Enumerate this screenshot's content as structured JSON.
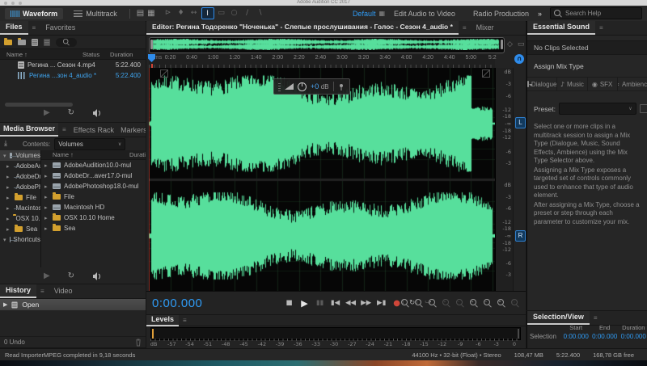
{
  "window": {
    "title": "Adobe Audition CC 2017"
  },
  "toolbar": {
    "waveform_label": "Waveform",
    "multitrack_label": "Multitrack",
    "view_toggles": [
      {
        "name": "waveform-view",
        "glyph": "▤"
      },
      {
        "name": "spectral-view",
        "glyph": "▦"
      }
    ],
    "tools": [
      {
        "name": "move",
        "glyph": "⊳",
        "active": false
      },
      {
        "name": "razor",
        "glyph": "♦",
        "active": false
      },
      {
        "name": "slip",
        "glyph": "↔",
        "active": false
      },
      {
        "name": "time-selection",
        "glyph": "I",
        "active": true
      },
      {
        "name": "marquee-selection",
        "glyph": "▭",
        "active": false
      },
      {
        "name": "lasso-selection",
        "glyph": "○",
        "active": false
      },
      {
        "name": "paintbrush",
        "glyph": "∕",
        "active": false
      },
      {
        "name": "spot-healing",
        "glyph": "∖",
        "active": false
      }
    ],
    "workspace_current": "Default",
    "workspaces": [
      "Edit Audio to Video",
      "Radio Production"
    ],
    "overflow": "»",
    "search_placeholder": "Search Help"
  },
  "files_panel": {
    "tabs": [
      "Files",
      "Favorites"
    ],
    "columns": [
      "Name ↑",
      "Status",
      "Duration"
    ],
    "rows": [
      {
        "name": "Регина ... Сезон 4.mp4",
        "duration": "5:22.400",
        "type": "video",
        "selected": false
      },
      {
        "name": "Регина ...зон 4_audio *",
        "duration": "5:22.400",
        "type": "audio",
        "selected": true
      }
    ]
  },
  "media_browser": {
    "tabs": [
      "Media Browser",
      "Effects Rack",
      "Markers"
    ],
    "overflow": "»",
    "contents_label": "Contents:",
    "contents_value": "Volumes",
    "tree_root": "Volumes",
    "tree_root2": "Shortcuts",
    "name_column": "Name ↑",
    "duration_column": "Duration",
    "items": [
      {
        "name": "AdobeAudition10.0-mul",
        "icon": "drive"
      },
      {
        "name": "AdobeDr...aver17.0-mul",
        "icon": "drive"
      },
      {
        "name": "AdobePhotoshop18.0-mul",
        "icon": "drive"
      },
      {
        "name": "File",
        "icon": "folder"
      },
      {
        "name": "Macintosh HD",
        "icon": "drive"
      },
      {
        "name": "OSX 10.10 Home",
        "icon": "folder"
      },
      {
        "name": "Sea",
        "icon": "folder"
      }
    ]
  },
  "history_panel": {
    "tabs": [
      "History",
      "Video"
    ],
    "items": [
      "Open"
    ],
    "undo_label": "0 Undo"
  },
  "editor": {
    "tab_label": "Editor: Регина Тодоренко \"Ноченька\" - Слепые прослушивания - Голос - Сезон 4_audio *",
    "mixer_tab": "Mixer",
    "ruler_unit": "hms",
    "ruler_ticks": [
      "0:20",
      "0:40",
      "1:00",
      "1:20",
      "1:40",
      "2:00",
      "2:20",
      "2:40",
      "3:00",
      "3:20",
      "3:40",
      "4:00",
      "4:20",
      "4:40",
      "5:00",
      "5:2"
    ],
    "hud_gain_value": "+0",
    "hud_gain_unit": "dB",
    "db_scale": [
      "dB",
      "-3",
      "-6",
      "-12",
      "-18",
      "-∞",
      "-18",
      "-12",
      "-6",
      "-3"
    ],
    "channels": [
      "L",
      "R"
    ]
  },
  "transport": {
    "time": "0:00.000",
    "buttons": [
      {
        "name": "stop",
        "glyph": "■",
        "style": ""
      },
      {
        "name": "play",
        "glyph": "▶",
        "style": "play"
      },
      {
        "name": "pause",
        "glyph": "▮▮",
        "style": "dim"
      },
      {
        "name": "skip-to-start",
        "glyph": "▮◀",
        "style": ""
      },
      {
        "name": "rewind",
        "glyph": "◀◀",
        "style": ""
      },
      {
        "name": "fast-forward",
        "glyph": "▶▶",
        "style": ""
      },
      {
        "name": "skip-to-end",
        "glyph": "▶▮",
        "style": ""
      },
      {
        "name": "record",
        "glyph": "●",
        "style": "rec"
      },
      {
        "name": "loop-playback",
        "glyph": "↻",
        "style": ""
      },
      {
        "name": "skip-selection",
        "glyph": "↪",
        "style": "dim"
      }
    ],
    "zoom_tools": [
      {
        "name": "zoom-in-at-in-point",
        "glyph": "[",
        "dim": false
      },
      {
        "name": "zoom-in-at-out-point",
        "glyph": "]",
        "dim": false
      },
      {
        "name": "zoom-to-selection",
        "glyph": "▪",
        "dim": false
      },
      {
        "name": "zoom-amplitude-in",
        "glyph": "+",
        "dim": true
      },
      {
        "name": "zoom-amplitude-out",
        "glyph": "−",
        "dim": true
      },
      {
        "name": "zoom-in-time",
        "glyph": "+",
        "dim": false
      },
      {
        "name": "zoom-out-time",
        "glyph": "−",
        "dim": false
      },
      {
        "name": "zoom-out-full",
        "glyph": "=",
        "dim": false
      },
      {
        "name": "zoom-reset",
        "glyph": "□",
        "dim": true
      }
    ]
  },
  "levels_panel": {
    "title": "Levels",
    "scale": [
      "dB",
      "-57",
      "-54",
      "-51",
      "-48",
      "-45",
      "-42",
      "-39",
      "-36",
      "-33",
      "-30",
      "-27",
      "-24",
      "-21",
      "-18",
      "-15",
      "-12",
      "-9",
      "-6",
      "-3",
      "0"
    ]
  },
  "essential_sound": {
    "title": "Essential Sound",
    "status": "No Clips Selected",
    "assign_label": "Assign Mix Type",
    "mix_types": [
      {
        "label": "Dialogue",
        "icon": "speech-bubble",
        "glyph": ""
      },
      {
        "label": "Music",
        "icon": "music-note",
        "glyph": "♪"
      },
      {
        "label": "SFX",
        "icon": "sfx",
        "glyph": "◉"
      },
      {
        "label": "Ambience",
        "icon": "ambience",
        "glyph": "≈"
      }
    ],
    "preset_label": "Preset:",
    "description": [
      "Select one or more clips in a multitrack session to assign a Mix Type (Dialogue, Music, Sound Effects, Ambience) using the Mix Type Selector above.",
      "Assigning a Mix Type exposes a targeted set of controls commonly used to enhance that type of audio element.",
      "After assigning a Mix Type, choose a preset or step through each parameter to customize your mix."
    ]
  },
  "selection_view": {
    "title": "Selection/View",
    "columns": [
      "Start",
      "End",
      "Duration"
    ],
    "row_label": "Selection",
    "row": {
      "start": "0:00.000",
      "end": "0:00.000",
      "duration": "0:00.000"
    }
  },
  "status_bar": {
    "left": "Read ImporterMPEG completed in 9,18 seconds",
    "format": "44100 Hz • 32-bit (Float) • Stereo",
    "size": "108,47 MB",
    "duration": "5:22.400",
    "free": "168,78 GB free"
  },
  "colors": {
    "accent": "#2f9bf4",
    "waveform": "#57df9c",
    "record": "#cf4639",
    "folder": "#d3a02e"
  }
}
